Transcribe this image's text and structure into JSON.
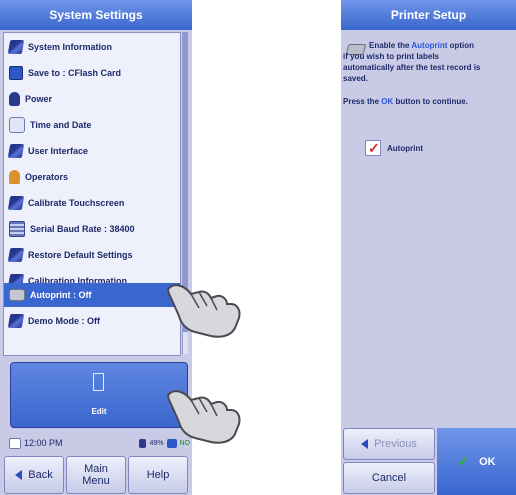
{
  "left_screen": {
    "title": "System Settings",
    "menu_items": [
      {
        "label": "System Information",
        "icon": "book-icon"
      },
      {
        "label": "Save to : CFlash Card",
        "icon": "disk-icon"
      },
      {
        "label": "Power",
        "icon": "power-icon"
      },
      {
        "label": "Time and Date",
        "icon": "clock-icon"
      },
      {
        "label": "User Interface",
        "icon": "book-icon"
      },
      {
        "label": "Operators",
        "icon": "person-icon"
      },
      {
        "label": "Calibrate Touchscreen",
        "icon": "book-icon"
      },
      {
        "label": "Serial Baud Rate : 38400",
        "icon": "serial-icon"
      },
      {
        "label": "Restore Default Settings",
        "icon": "book-icon"
      },
      {
        "label": "Calibration Information",
        "icon": "book-icon"
      },
      {
        "label": "Autoprint : Off",
        "icon": "printer-icon",
        "selected": true
      },
      {
        "label": "Demo Mode : Off",
        "icon": "book-icon"
      }
    ],
    "edit_label": "Edit",
    "status": {
      "time": "12:00 PM",
      "battery": "49%",
      "storage": "NO"
    },
    "buttons": {
      "back": "Back",
      "main_menu_line1": "Main",
      "main_menu_line2": "Menu",
      "help": "Help"
    }
  },
  "right_screen": {
    "title": "Printer Setup",
    "text_line1_prefix": "Enable the ",
    "text_line1_highlight": "Autoprint",
    "text_line1_suffix": " option",
    "text_line2": "if you wish to print labels",
    "text_line3": "automatically after the test record is",
    "text_line4": "saved.",
    "instruction_prefix": "Press the ",
    "instruction_highlight": "OK",
    "instruction_suffix": " button to continue.",
    "checkbox_label": "Autoprint",
    "checkbox_checked": true,
    "buttons": {
      "previous": "Previous",
      "cancel": "Cancel",
      "ok": "OK"
    }
  },
  "colors": {
    "accent": "#3a66cf",
    "screen_bg": "#c9cbe6",
    "selected_item": "#3a66cf"
  }
}
